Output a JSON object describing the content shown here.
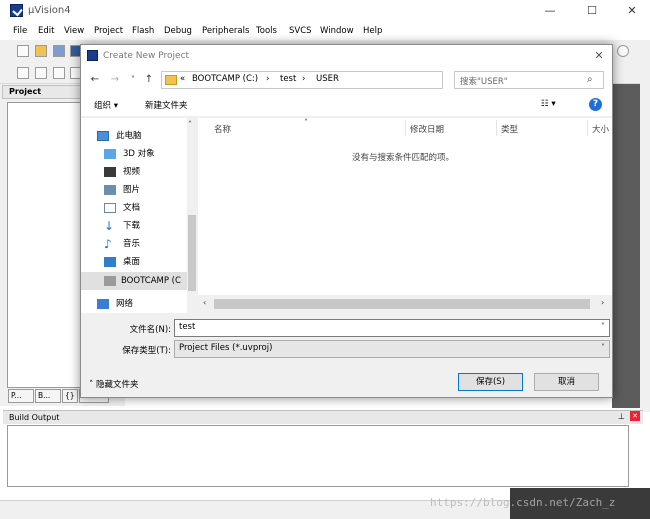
{
  "main_window": {
    "title": "µVision4",
    "controls": [
      "—",
      "☐",
      "✕"
    ],
    "menu": [
      "File",
      "Edit",
      "View",
      "Project",
      "Flash",
      "Debug",
      "Peripherals",
      "Tools",
      "SVCS",
      "Window",
      "Help"
    ],
    "project_panel_title": "Project",
    "project_tabs": [
      "P...",
      "B...",
      "{}",
      "0..."
    ],
    "build_output_title": "Build Output",
    "watermark": "https://blog.csdn.net/Zach_z"
  },
  "dialog": {
    "title": "Create New Project",
    "close": "✕",
    "nav": {
      "back": "←",
      "forward": "→",
      "dropdown": "˅",
      "up": "↑"
    },
    "breadcrumb": [
      "«",
      "BOOTCAMP (C:)",
      "›",
      "test",
      "›",
      "USER"
    ],
    "search_placeholder": "搜索\"USER\"",
    "organize": "组织 ▾",
    "new_folder": "新建文件夹",
    "view_icon": "☷ ▾",
    "help": "?",
    "nav_pane": [
      {
        "label": "此电脑",
        "icon": "computer-icon"
      },
      {
        "label": "3D 对象",
        "icon": "3d-objects-icon"
      },
      {
        "label": "视频",
        "icon": "video-icon"
      },
      {
        "label": "图片",
        "icon": "pictures-icon"
      },
      {
        "label": "文档",
        "icon": "documents-icon"
      },
      {
        "label": "下载",
        "icon": "download-icon"
      },
      {
        "label": "音乐",
        "icon": "music-icon"
      },
      {
        "label": "桌面",
        "icon": "desktop-icon"
      },
      {
        "label": "BOOTCAMP (C",
        "icon": "drive-icon"
      },
      {
        "label": "网络",
        "icon": "network-icon"
      }
    ],
    "columns": [
      "名称",
      "修改日期",
      "类型",
      "大小"
    ],
    "empty_message": "没有与搜索条件匹配的项。",
    "filename_label": "文件名(N):",
    "filename_value": "test",
    "filetype_label": "保存类型(T):",
    "filetype_value": "Project Files (*.uvproj)",
    "hide_folders": "隐藏文件夹",
    "save": "保存(S)",
    "cancel": "取消"
  }
}
